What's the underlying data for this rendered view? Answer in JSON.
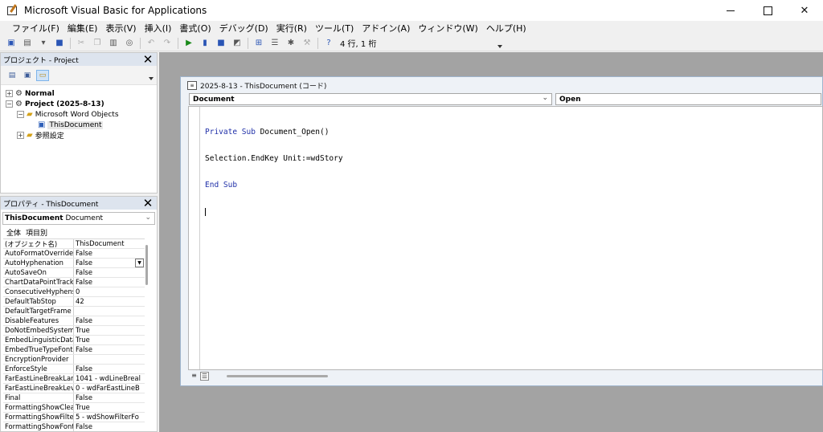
{
  "window": {
    "title": "Microsoft Visual Basic for Applications"
  },
  "menu": [
    "ファイル(F)",
    "編集(E)",
    "表示(V)",
    "挿入(I)",
    "書式(O)",
    "デバッグ(D)",
    "実行(R)",
    "ツール(T)",
    "アドイン(A)",
    "ウィンドウ(W)",
    "ヘルプ(H)"
  ],
  "toolbar": {
    "cursor_position": "4 行, 1 桁"
  },
  "project": {
    "title": "プロジェクト - Project",
    "nodes": {
      "normal": "Normal",
      "project": "Project (2025-8-13)",
      "word_objects": "Microsoft Word Objects",
      "this_document": "ThisDocument",
      "references": "参照設定"
    }
  },
  "properties": {
    "title": "プロパティ - ThisDocument",
    "object_name": "ThisDocument",
    "object_type": "Document",
    "tabs": [
      "全体",
      "項目別"
    ],
    "rows": [
      [
        "(オブジェクト名)",
        "ThisDocument"
      ],
      [
        "AutoFormatOverride",
        "False"
      ],
      [
        "AutoHyphenation",
        "False"
      ],
      [
        "AutoSaveOn",
        "False"
      ],
      [
        "ChartDataPointTrack",
        "False"
      ],
      [
        "ConsecutiveHyphens",
        "0"
      ],
      [
        "DefaultTabStop",
        "42"
      ],
      [
        "DefaultTargetFrame",
        ""
      ],
      [
        "DisableFeatures",
        "False"
      ],
      [
        "DoNotEmbedSystemF",
        "True"
      ],
      [
        "EmbedLinguisticData",
        "True"
      ],
      [
        "EmbedTrueTypeFonts",
        "False"
      ],
      [
        "EncryptionProvider",
        ""
      ],
      [
        "EnforceStyle",
        "False"
      ],
      [
        "FarEastLineBreakLan",
        "1041 - wdLineBreal"
      ],
      [
        "FarEastLineBreakLev",
        "0 - wdFarEastLineB"
      ],
      [
        "Final",
        "False"
      ],
      [
        "FormattingShowClear",
        "True"
      ],
      [
        "FormattingShowFilter",
        "5 - wdShowFilterFo"
      ],
      [
        "FormattingShowFont",
        "False"
      ]
    ]
  },
  "code_window": {
    "title": "2025-8-13 - ThisDocument (コード)",
    "object_combo": "Document",
    "proc_combo": "Open",
    "lines": {
      "l1_kw": "Private Sub",
      "l1_rest": " Document_Open()",
      "l2": "Selection.EndKey Unit:=wdStory",
      "l3_kw": "End Sub"
    }
  }
}
